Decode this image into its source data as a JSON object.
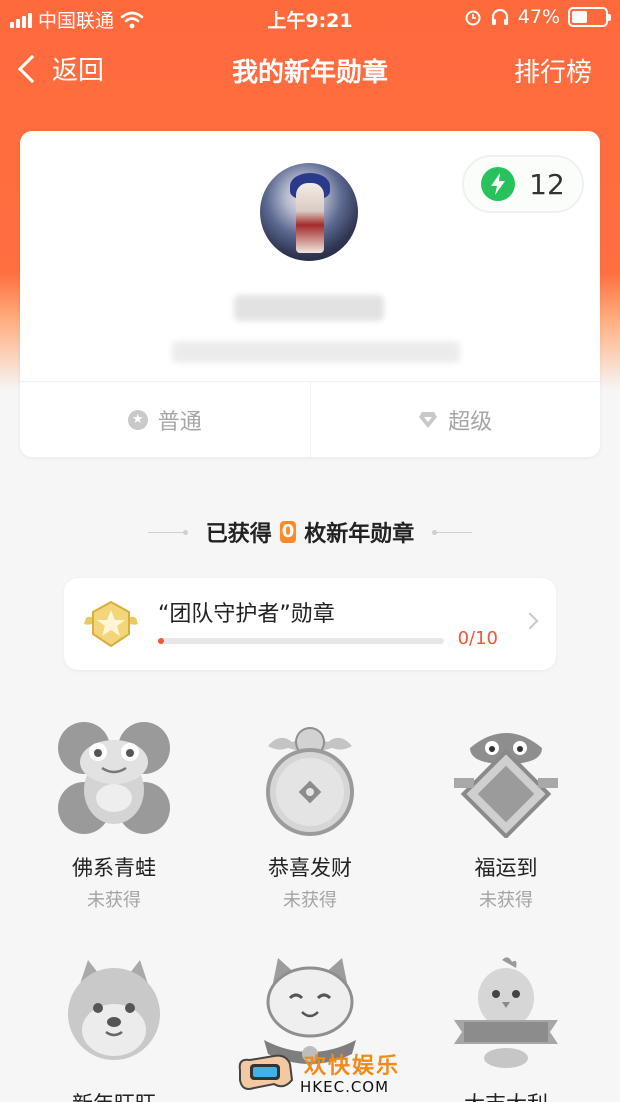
{
  "status_bar": {
    "carrier": "中国联通",
    "time": "上午9:21",
    "battery": "47%",
    "battery_level": 0.47
  },
  "nav": {
    "back_label": "返回",
    "title": "我的新年勋章",
    "leaderboard_label": "排行榜"
  },
  "profile": {
    "energy_count": "12",
    "energy_color": "#27c25c",
    "tabs": [
      {
        "label": "普通",
        "icon": "star-circle-icon"
      },
      {
        "label": "超级",
        "icon": "diamond-icon"
      }
    ]
  },
  "earned": {
    "prefix": "已获得",
    "count": "0",
    "suffix": "枚新年勋章"
  },
  "guardian_medal": {
    "title": "“团队守护者”勋章",
    "progress_text": "0/10",
    "progress": 0.0,
    "accent_color": "#f4553a"
  },
  "medals": [
    {
      "name": "佛系青蛙",
      "status": "未获得",
      "icon": "frog-medal-icon"
    },
    {
      "name": "恭喜发财",
      "status": "未获得",
      "icon": "coin-medal-icon"
    },
    {
      "name": "福运到",
      "status": "未获得",
      "icon": "lion-fu-medal-icon"
    },
    {
      "name": "新年旺旺",
      "status": "",
      "icon": "shiba-medal-icon"
    },
    {
      "name": "",
      "status": "",
      "icon": "lucky-cat-medal-icon"
    },
    {
      "name": "大吉大利",
      "status": "",
      "icon": "chick-medal-icon"
    }
  ],
  "watermark": {
    "line1": "欢快娱乐",
    "line2": "HKEC.COM"
  },
  "colors": {
    "header": "#ff6a3d",
    "background": "#f6f6f6"
  }
}
